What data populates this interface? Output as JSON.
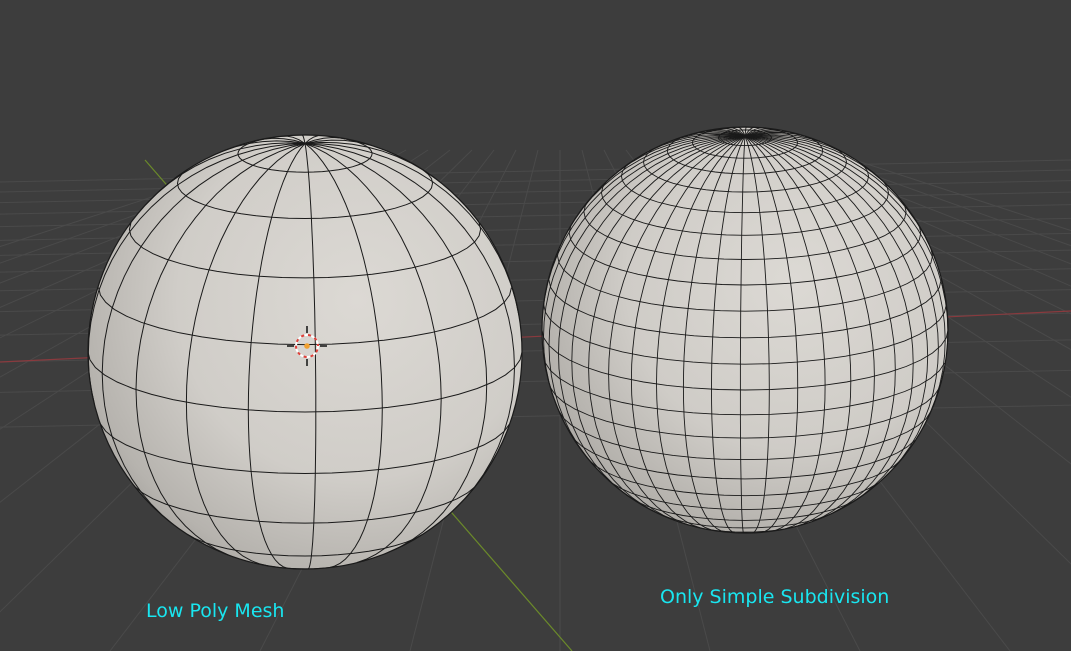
{
  "labels": {
    "left_sphere": "Low Poly Mesh",
    "right_sphere": "Only Simple Subdivision"
  },
  "colors": {
    "background": "#3d3d3d",
    "grid_line": "#4a4a4a",
    "x_axis": "#8a3a3e",
    "y_axis": "#6b8a2a",
    "label_text": "#19e6f0",
    "mesh_surface": "#d4d1cc",
    "mesh_wire": "#1a1a1a"
  },
  "icons": {
    "cursor": "3d-cursor-icon"
  }
}
